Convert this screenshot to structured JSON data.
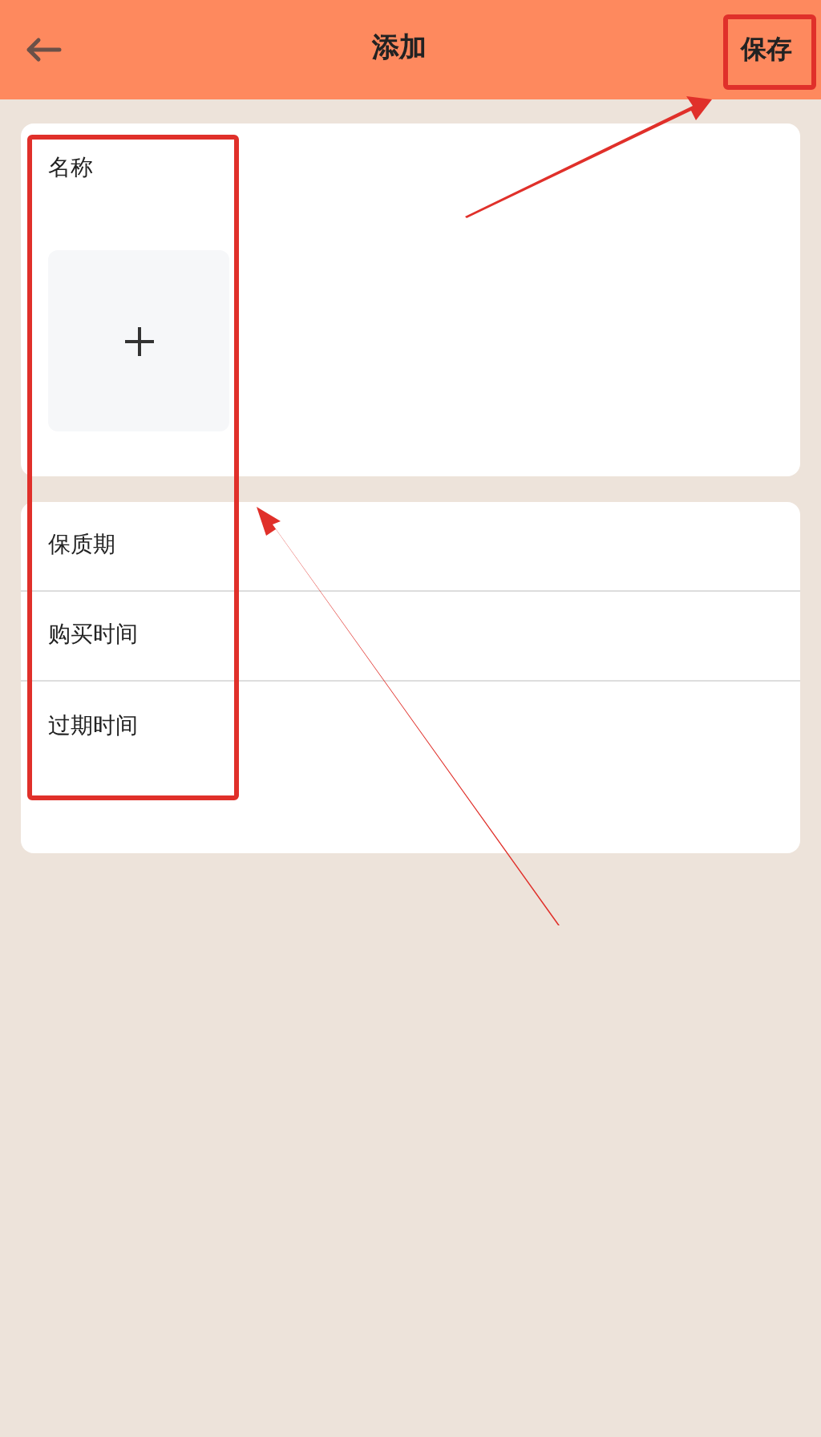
{
  "header": {
    "title": "添加",
    "save_button": "保存"
  },
  "name_card": {
    "label": "名称"
  },
  "fields": [
    {
      "label": "保质期"
    },
    {
      "label": "购买时间"
    },
    {
      "label": "过期时间"
    }
  ]
}
